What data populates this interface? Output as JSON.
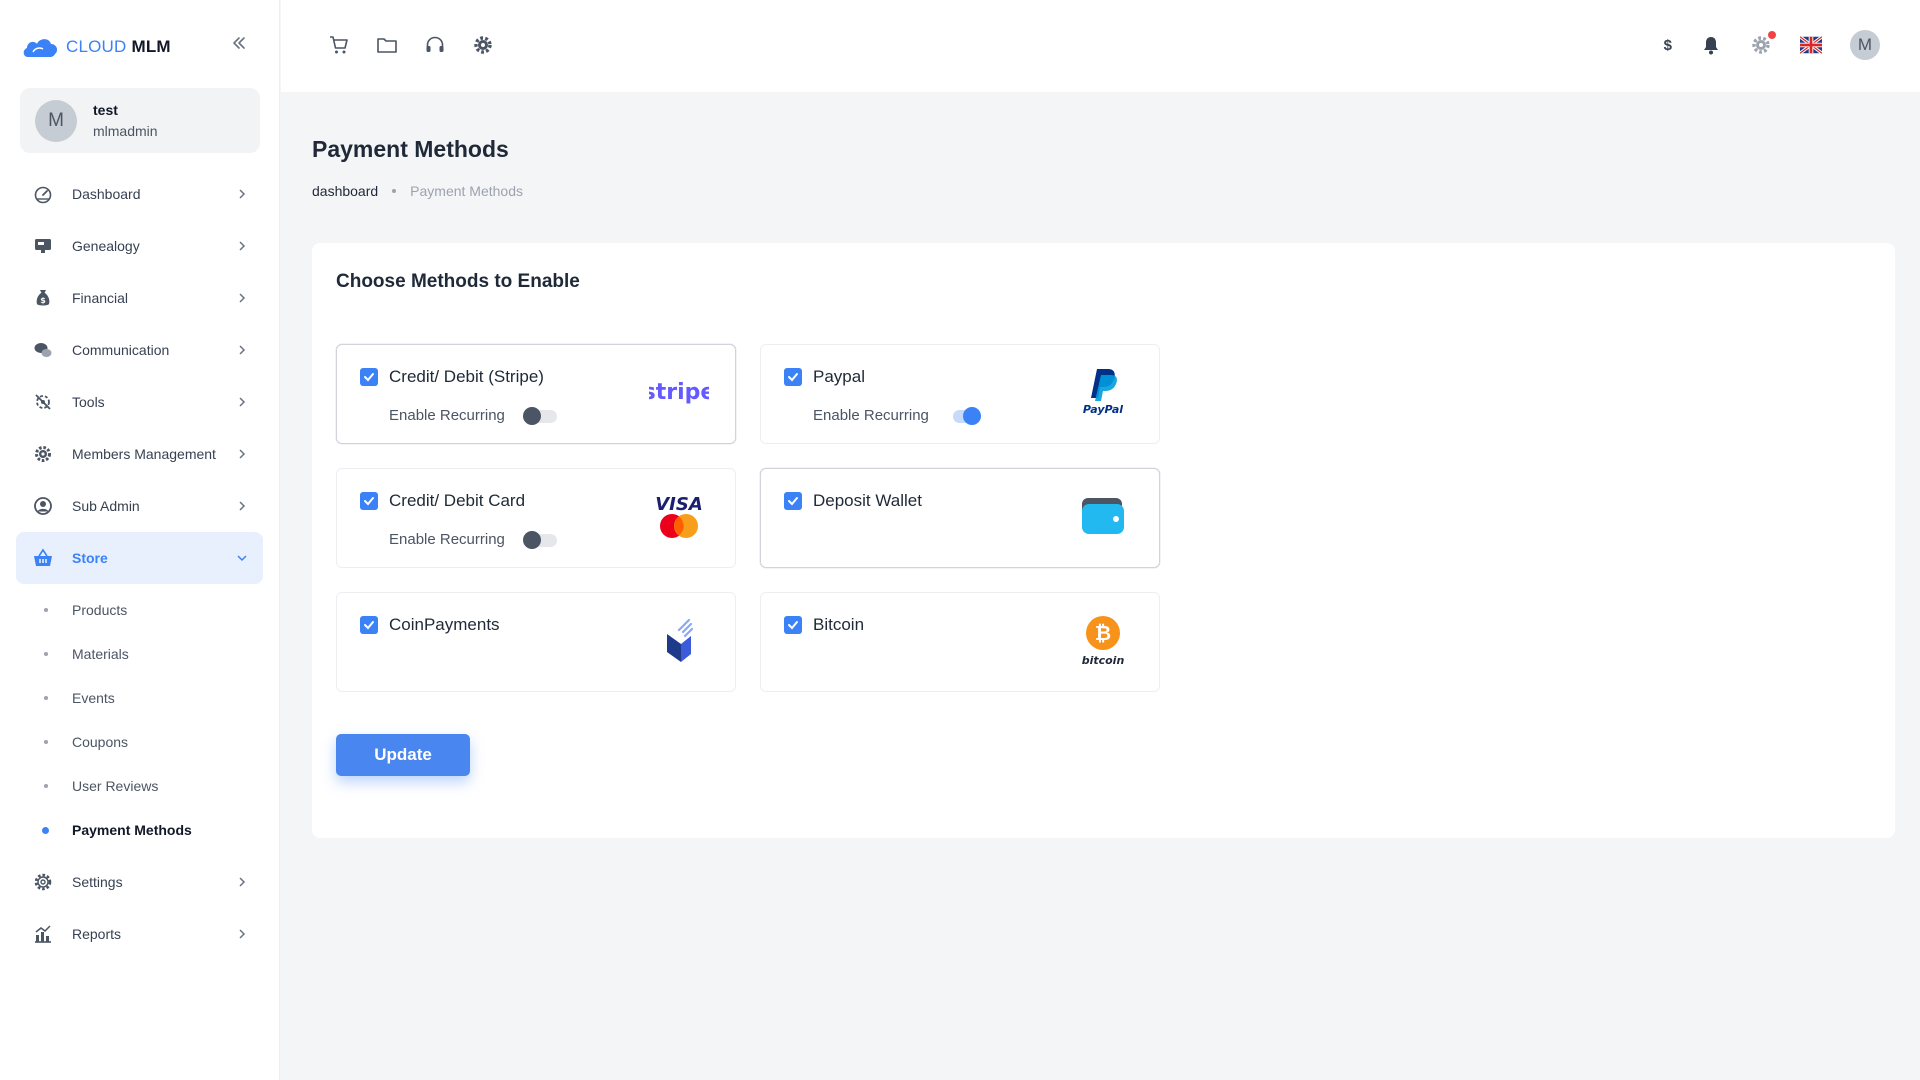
{
  "brand": {
    "part1": "CLOUD",
    "part2": "MLM",
    "primary_color": "#3b82f6"
  },
  "user": {
    "initial": "M",
    "name": "test",
    "role": "mlmadmin"
  },
  "sidebar": {
    "items": [
      {
        "label": "Dashboard",
        "icon": "dashboard-gauge-icon"
      },
      {
        "label": "Genealogy",
        "icon": "monitor-icon"
      },
      {
        "label": "Financial",
        "icon": "money-bag-icon"
      },
      {
        "label": "Communication",
        "icon": "chat-bubbles-icon"
      },
      {
        "label": "Tools",
        "icon": "tools-icon"
      },
      {
        "label": "Members Management",
        "icon": "cog-icon"
      },
      {
        "label": "Sub Admin",
        "icon": "user-circle-icon"
      },
      {
        "label": "Store",
        "icon": "basket-icon",
        "active": true
      },
      {
        "label": "Settings",
        "icon": "settings-icon"
      },
      {
        "label": "Reports",
        "icon": "chart-icon"
      }
    ],
    "store_sub": [
      "Products",
      "Materials",
      "Events",
      "Coupons",
      "User Reviews",
      "Payment Methods"
    ]
  },
  "topbar": {
    "left_icons": [
      "cart-icon",
      "folder-icon",
      "headset-icon",
      "gear-icon"
    ],
    "currency": "$",
    "avatar_initial": "M"
  },
  "page": {
    "title": "Payment Methods",
    "breadcrumb": {
      "home": "dashboard",
      "current": "Payment Methods"
    }
  },
  "card": {
    "title": "Choose Methods to Enable",
    "recurring_label": "Enable Recurring",
    "methods": [
      {
        "name": "Credit/ Debit (Stripe)",
        "checked": true,
        "recurring": false,
        "logo": "stripe"
      },
      {
        "name": "Paypal",
        "checked": true,
        "recurring": true,
        "logo": "PayPal"
      },
      {
        "name": "Credit/ Debit Card",
        "checked": true,
        "recurring": false,
        "logo": "VISA"
      },
      {
        "name": "Deposit Wallet",
        "checked": true,
        "logo": "wallet-icon"
      },
      {
        "name": "CoinPayments",
        "checked": true,
        "logo": "coinpayments-logo"
      },
      {
        "name": "Bitcoin",
        "checked": true,
        "logo": "bitcoin"
      }
    ],
    "update_label": "Update"
  }
}
